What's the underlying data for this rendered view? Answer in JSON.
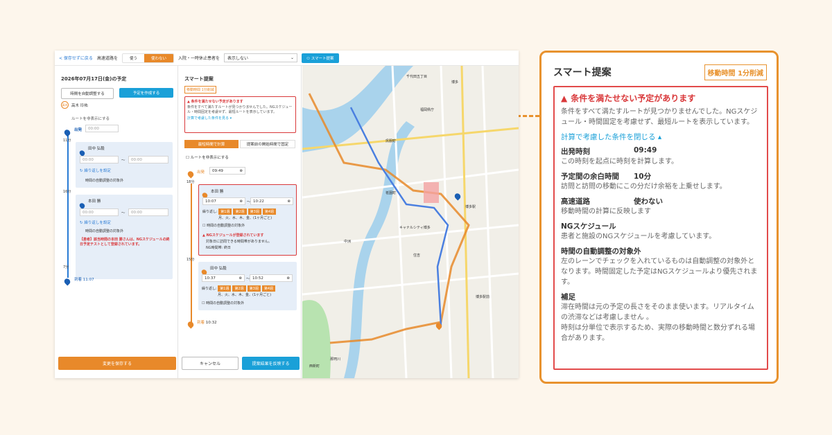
{
  "topbar": {
    "back_label": "< 保存せずに戻る",
    "highway_label": "高速道路を",
    "highway_use": "使う",
    "highway_nouse": "使わない",
    "inpatient_label": "入院・一時休止患者を",
    "inpatient_value": "表示しない",
    "smart_button": "スマート提案"
  },
  "left": {
    "date_title": "2026年07月17日(金)の予定",
    "auto_create_button": "時間を自動調整する",
    "create_button": "予定を作成する",
    "user_initial": "高木",
    "user_name": "高木 玲祐",
    "route_hide": "ルートを非表示にする",
    "depart_label": "出発",
    "depart_time": "00:00",
    "gap1": "11分",
    "stop1_name": "田中 弘毅",
    "stop1_from": "00:00",
    "stop1_to": "00:00",
    "tilde": "〜",
    "repeat_link": "繰り返しを設定",
    "auto_exclude": "時間の自動調整の対象外",
    "gap2": "16分",
    "stop2_name": "本田 勝",
    "stop2_from": "00:00",
    "stop2_to": "00:00",
    "repeat_link2": "繰り返しを設定",
    "auto_exclude2": "時間の自動調整の対象外",
    "warning_text": "【患者】該当時間の本田 勝さんは、NGスケジュールの終日予定テストとして登録されています。",
    "gap3": "7分",
    "arrive_label": "到着",
    "arrive_time": "11:07",
    "save_button": "変更を保存する"
  },
  "middle": {
    "title": "スマート提案",
    "badge": "移動時間 1分削減",
    "warn_title": "条件を満たせない予定があります",
    "warn_body": "条件をすべて満たすルートが見つかりませんでした。NGスケジュール・時間固定を考慮せず、最短ルートを表示しています。",
    "warn_link": "計算で考慮した条件を見る ▾",
    "tab_active": "最短時間で計算",
    "tab_inactive": "提案前の開始時間で固定",
    "route_hide": "ルートを非表示にする",
    "depart_label": "出発",
    "depart_time": "09:49",
    "gap1": "18分",
    "stop1_name": "本田 勝",
    "stop1_from": "10:07",
    "stop1_to": "10:22",
    "repeat_label": "繰り返し:",
    "weeks": [
      "第1週",
      "第2週",
      "第3週",
      "第4週"
    ],
    "days": "月、火、水、木、金、(1ヶ月ごと)",
    "auto_exclude": "時間の自動調整の対象外",
    "ng_title": "NGスケジュールが登録されています",
    "ng_body": "対象日に訪問できる時間帯がありません。",
    "ng_detail": "NG時間帯: 終日",
    "gap2": "15分",
    "stop2_name": "田中 弘毅",
    "stop2_from": "10:37",
    "stop2_to": "10:52",
    "auto_exclude2": "時間の自動調整の対象外",
    "arrive_label": "到着",
    "arrive_time": "10:32",
    "cancel_button": "キャンセル",
    "apply_button": "提案結果を反映する"
  },
  "map": {
    "labels": [
      "千代田五丁目",
      "博多",
      "福岡県庁",
      "呉服町",
      "博多駅",
      "キャナルシティ博多",
      "住吉",
      "祇園町",
      "博多駅前",
      "中洲",
      "那珂川",
      "西新町"
    ]
  },
  "callout": {
    "title": "スマート提案",
    "badge": "移動時間 1分削減",
    "warn_title": "条件を満たせない予定があります",
    "warn_body": "条件をすべて満たすルートが見つかりませんでした。NGスケジュール・時間固定を考慮せず、最短ルートを表示しています。",
    "link": "計算で考慮した条件を閉じる ▴",
    "rows": [
      {
        "key": "出発時刻",
        "val": "09:49",
        "desc": "この時刻を起点に時刻を計算します。"
      },
      {
        "key": "予定間の余白時間",
        "val": "10分",
        "desc": "訪問と訪問の移動にこの分だけ余裕を上乗せします。"
      },
      {
        "key": "高速道路",
        "val": "使わない",
        "desc": "移動時間の計算に反映します"
      },
      {
        "key": "NGスケジュール",
        "val": "",
        "desc": "患者と施設のNGスケジュールを考慮しています。"
      },
      {
        "key": "時間の自動調整の対象外",
        "val": "",
        "desc": "左のレーンでチェックを入れているものは自動調整の対象外となります。時間固定した予定はNGスケジュールより優先されます。"
      },
      {
        "key": "補足",
        "val": "",
        "desc": "滞在時間は元の予定の長さをそのまま使います。リアルタイムの渋滞などは考慮しません 。\n時刻は分単位で表示するため、実際の移動時間と数分ずれる場合があります。"
      }
    ]
  },
  "colors": {
    "accent": "#e8922e",
    "blue": "#1aa0d8",
    "red": "#d9383a"
  }
}
